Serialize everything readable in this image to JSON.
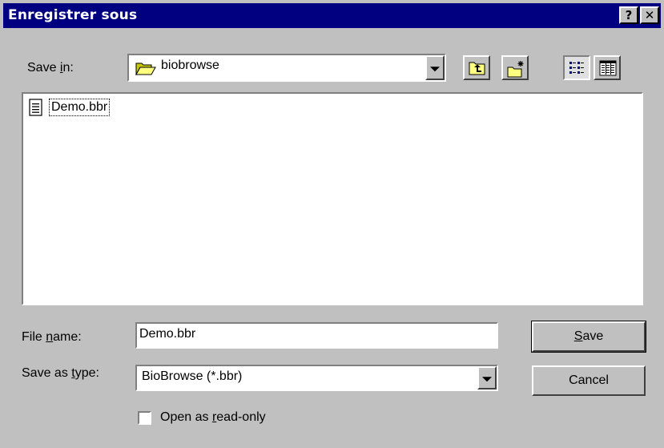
{
  "window": {
    "title": "Enregistrer sous",
    "help_label": "?",
    "close_label": "✕"
  },
  "save_in": {
    "label_pre": "Save ",
    "label_accel": "i",
    "label_post": "n:",
    "value": "biobrowse",
    "folder_icon": "open-folder-icon"
  },
  "toolbar": {
    "up_icon": "up-one-level-icon",
    "new_folder_icon": "create-new-folder-icon",
    "list_icon": "list-view-icon",
    "details_icon": "details-view-icon"
  },
  "files": [
    {
      "name": "Demo.bbr",
      "icon": "document-icon"
    }
  ],
  "file_name": {
    "label_pre": "File ",
    "label_accel": "n",
    "label_post": "ame:",
    "value": "Demo.bbr"
  },
  "save_type": {
    "label_pre": "Save as ",
    "label_accel": "t",
    "label_post": "ype:",
    "value": "BioBrowse (*.bbr)"
  },
  "buttons": {
    "save_accel": "S",
    "save_rest": "ave",
    "cancel": "Cancel"
  },
  "read_only": {
    "label_pre": "Open as ",
    "label_accel": "r",
    "label_post": "ead-only",
    "checked": false
  },
  "colors": {
    "titlebar": "#000080",
    "face": "#c0c0c0"
  }
}
